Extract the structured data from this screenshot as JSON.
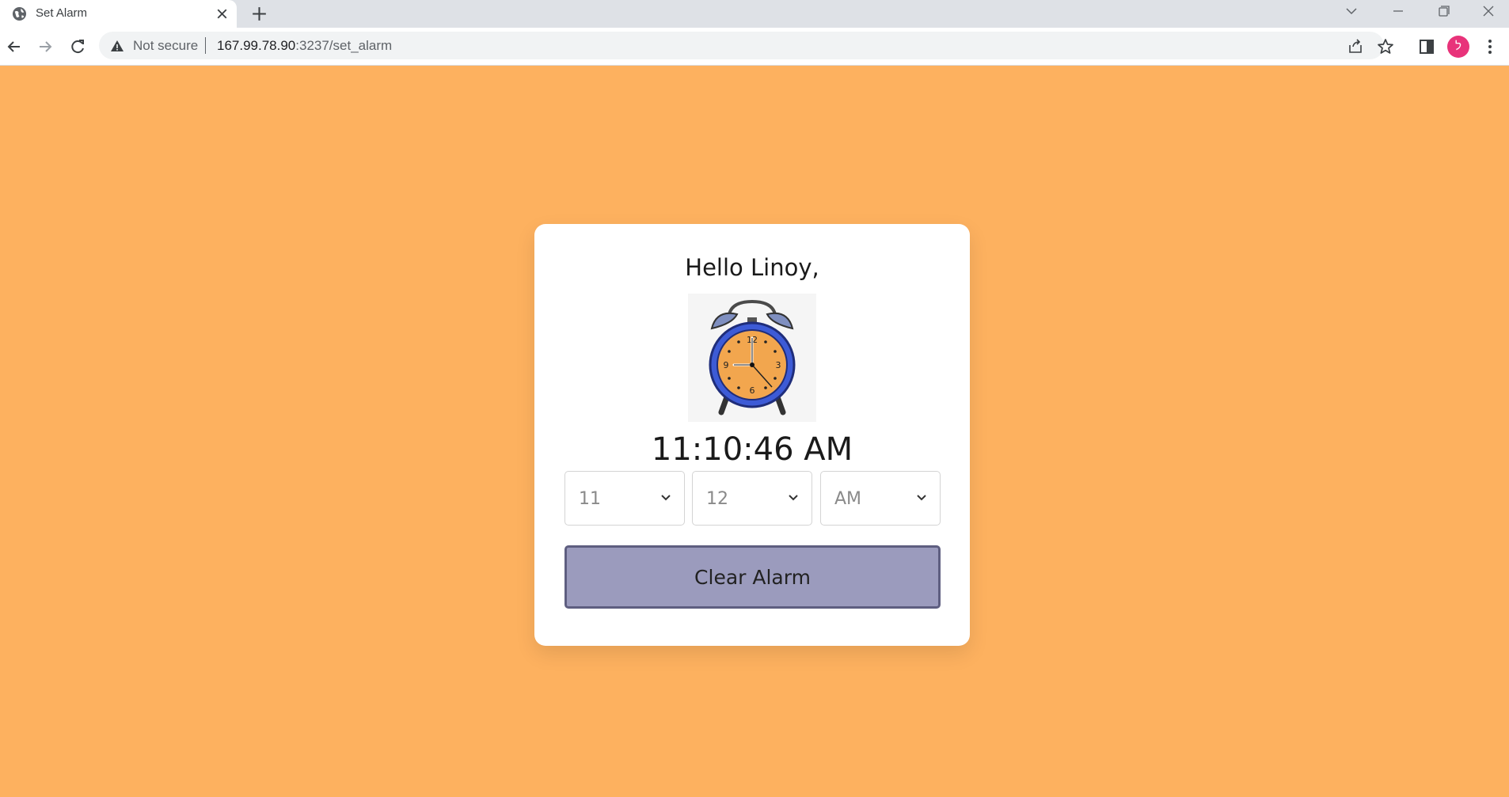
{
  "browser": {
    "tab_title": "Set Alarm",
    "security_label": "Not secure",
    "url_host": "167.99.78.90",
    "url_rest": ":3237/set_alarm",
    "profile_initial": "ל"
  },
  "page": {
    "background_color": "#fdb15f",
    "greeting": "Hello Linoy,",
    "clock_image": "alarm-clock-icon",
    "current_time": "11:10:46 AM",
    "hour_select": {
      "value": "11"
    },
    "minute_select": {
      "value": "12"
    },
    "ampm_select": {
      "value": "AM"
    },
    "clear_button_label": "Clear Alarm",
    "button_color": "#9b9bbd"
  }
}
